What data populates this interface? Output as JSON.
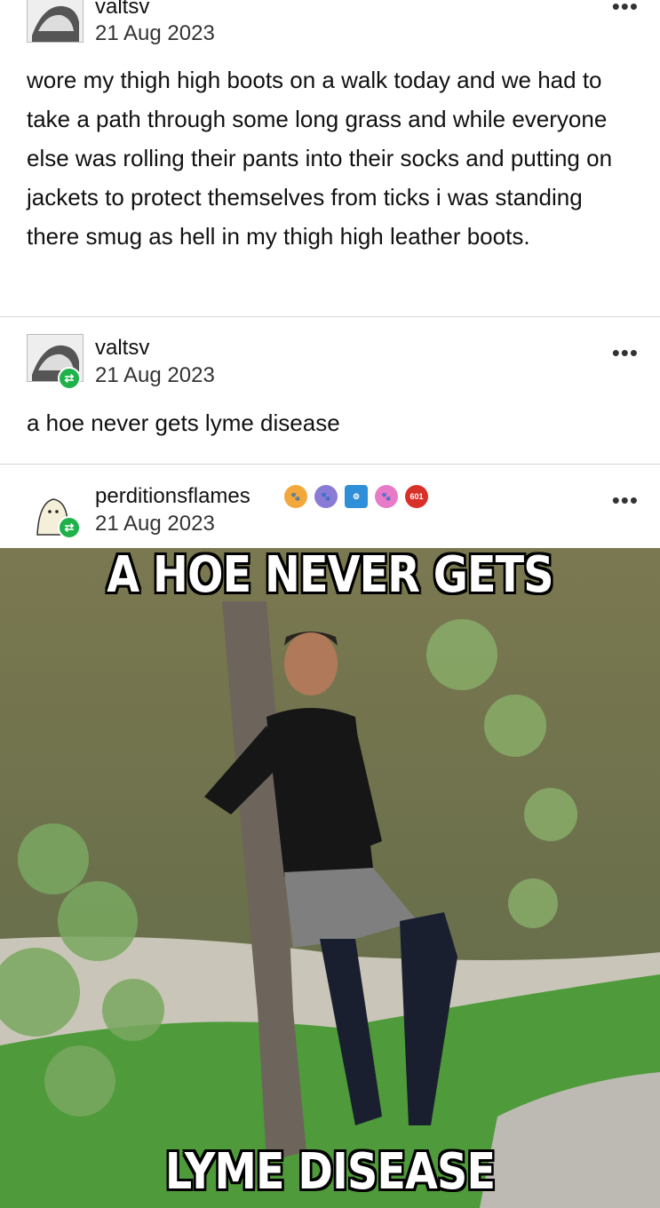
{
  "posts": [
    {
      "username": "valtsv",
      "date": "21 Aug 2023",
      "text": "wore my thigh high boots on a walk today and we had to take a path through some long grass and while everyone else was rolling their pants into their socks and putting on jackets to protect themselves from ticks i was standing there smug as hell in my thigh high leather boots."
    },
    {
      "username": "valtsv",
      "date": "21 Aug 2023",
      "text": "a hoe never gets lyme disease"
    },
    {
      "username": "perditionsflames",
      "date": "21 Aug 2023",
      "badge_text": "601"
    }
  ],
  "more_label": "•••",
  "meme": {
    "top_text": "A HOE NEVER GETS",
    "bottom_text": "LYME DISEASE"
  },
  "colors": {
    "reblog_green": "#1fb24a"
  }
}
